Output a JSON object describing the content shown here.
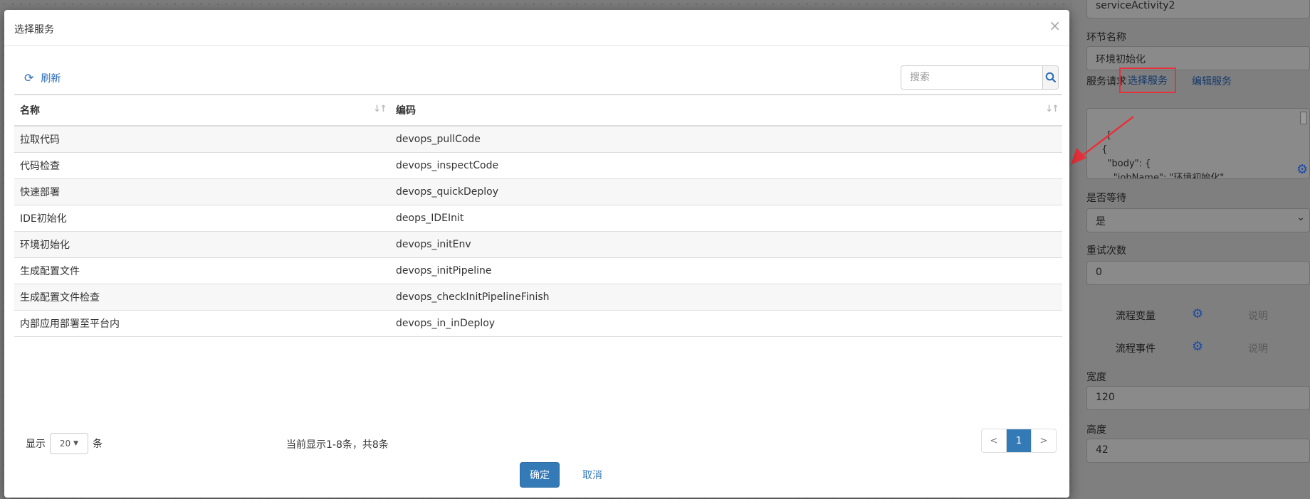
{
  "right_panel": {
    "top_value": "serviceActivity2",
    "step_name_label": "环节名称",
    "step_name_value": "环境初始化",
    "service_request_label": "服务请求",
    "select_service_link": "选择服务",
    "edit_service_link": "编辑服务",
    "request_json": "[\n  {\n    \"body\": {\n      \"jobName\": \"环境初始化\",\n      \"jobDescription\": \"环境初始化\",",
    "wait_label": "是否等待",
    "wait_value": "是",
    "retry_label": "重试次数",
    "retry_value": "0",
    "flow_var_label": "流程变量",
    "flow_var_desc": "说明",
    "flow_event_label": "流程事件",
    "flow_event_desc": "说明",
    "width_label": "宽度",
    "width_value": "120",
    "height_label": "高度",
    "height_value": "42"
  },
  "modal": {
    "title": "选择服务",
    "close_glyph": "×",
    "refresh_label": "刷新",
    "search_placeholder": "搜索",
    "columns": [
      "名称",
      "编码"
    ],
    "rows": [
      {
        "name": "拉取代码",
        "code": "devops_pullCode"
      },
      {
        "name": "代码检查",
        "code": "devops_inspectCode"
      },
      {
        "name": "快速部署",
        "code": "devops_quickDeploy"
      },
      {
        "name": "IDE初始化",
        "code": "deops_IDEInit"
      },
      {
        "name": "环境初始化",
        "code": "devops_initEnv"
      },
      {
        "name": "生成配置文件",
        "code": "devops_initPipeline"
      },
      {
        "name": "生成配置文件检查",
        "code": "devops_checkInitPipelineFinish"
      },
      {
        "name": "内部应用部署至平台内",
        "code": "devops_in_inDeploy"
      }
    ],
    "show_label": "显示",
    "page_size": "20",
    "per_label": "条",
    "info": "当前显示1-8条，共8条",
    "pager": {
      "prev": "<",
      "current": "1",
      "next": ">"
    },
    "ok_label": "确定",
    "cancel_label": "取消"
  },
  "colors": {
    "primary": "#337ab7",
    "highlight_border": "#e8313a",
    "link": "#2a6ab5"
  },
  "icons": {
    "refresh": "refresh-icon",
    "search": "search-icon",
    "gear": "gear-icon",
    "sort": "sort-icon"
  }
}
